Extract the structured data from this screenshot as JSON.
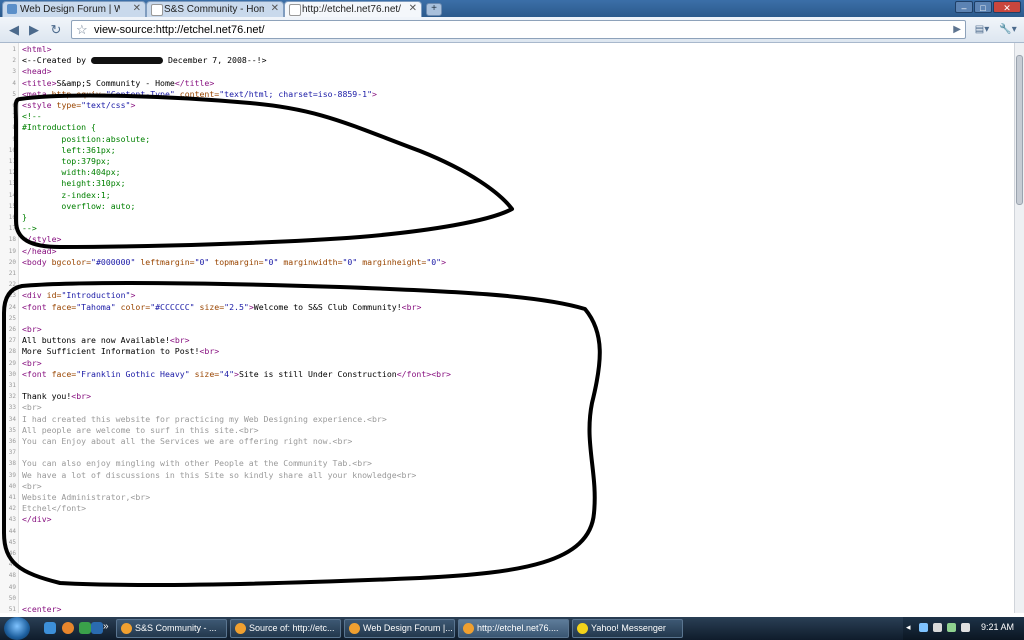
{
  "browser": {
    "tabs": [
      {
        "title": "Web Design Forum | Web...",
        "favicon_color": "#5b8fc9"
      },
      {
        "title": "S&S Community - Home",
        "favicon_color": "#ffffff"
      },
      {
        "title": "http://etchel.net76.net/",
        "favicon_color": "#ffffff"
      }
    ],
    "new_tab_label": "+",
    "window_controls": {
      "minimize": "–",
      "maximize": "□",
      "close": "✕"
    },
    "toolbar": {
      "back_icon": "back-arrow-icon",
      "forward_icon": "forward-arrow-icon",
      "reload_icon": "reload-icon",
      "url": "view-source:http://etchel.net76.net/",
      "go_label": "▶",
      "page_menu_label": "▾",
      "wrench_menu_label": "▾"
    }
  },
  "source": {
    "lines": [
      {
        "n": "1",
        "html": "<span class='tag'>&lt;html&gt;</span>"
      },
      {
        "n": "2",
        "html": "&lt;--Created by <span class='redact'></span> December 7, 2008--!&gt;"
      },
      {
        "n": "3",
        "html": "<span class='tag'>&lt;head&gt;</span>"
      },
      {
        "n": "4",
        "html": "<span class='tag'>&lt;title&gt;</span>S&amp;amp;S Community - Home<span class='tag'>&lt;/title&gt;</span>"
      },
      {
        "n": "5",
        "html": "<span class='tag'>&lt;meta</span> <span class='attr'>http-equiv=</span><span class='val'>\"Content-Type\"</span> <span class='attr'>content=</span><span class='val'>\"text/html; charset=iso-8859-1\"</span><span class='tag'>&gt;</span>"
      },
      {
        "n": "6",
        "html": "<span class='tag'>&lt;style</span> <span class='attr'>type=</span><span class='val'>\"text/css\"</span><span class='tag'>&gt;</span>"
      },
      {
        "n": "7",
        "html": "<span class='css'>&lt;!--</span>"
      },
      {
        "n": "8",
        "html": "<span class='css'>#Introduction {</span>"
      },
      {
        "n": "9",
        "html": "<span class='css'>        position:absolute;</span>"
      },
      {
        "n": "10",
        "html": "<span class='css'>        left:361px;</span>"
      },
      {
        "n": "11",
        "html": "<span class='css'>        top:379px;</span>"
      },
      {
        "n": "12",
        "html": "<span class='css'>        width:404px;</span>"
      },
      {
        "n": "13",
        "html": "<span class='css'>        height:310px;</span>"
      },
      {
        "n": "14",
        "html": "<span class='css'>        z-index:1;</span>"
      },
      {
        "n": "15",
        "html": "<span class='css'>        overflow: auto;</span>"
      },
      {
        "n": "16",
        "html": "<span class='css'>}</span>"
      },
      {
        "n": "17",
        "html": "<span class='css'>--&gt;</span>"
      },
      {
        "n": "18",
        "html": "<span class='tag'>&lt;/style&gt;</span>"
      },
      {
        "n": "19",
        "html": "<span class='tag'>&lt;/head&gt;</span>"
      },
      {
        "n": "20",
        "html": "<span class='tag'>&lt;body</span> <span class='attr'>bgcolor=</span><span class='val'>\"#000000\"</span> <span class='attr'>leftmargin=</span><span class='val'>\"0\"</span> <span class='attr'>topmargin=</span><span class='val'>\"0\"</span> <span class='attr'>marginwidth=</span><span class='val'>\"0\"</span> <span class='attr'>marginheight=</span><span class='val'>\"0\"</span><span class='tag'>&gt;</span>"
      },
      {
        "n": "21",
        "html": ""
      },
      {
        "n": "22",
        "html": ""
      },
      {
        "n": "23",
        "html": "<span class='tag'>&lt;div</span> <span class='attr'>id=</span><span class='val'>\"Introduction\"</span><span class='tag'>&gt;</span>"
      },
      {
        "n": "24",
        "html": "<span class='tag'>&lt;font</span> <span class='attr'>face=</span><span class='val'>\"Tahoma\"</span> <span class='attr'>color=</span><span class='val'>\"#CCCCCC\"</span> <span class='attr'>size=</span><span class='val'>\"2.5\"</span><span class='tag'>&gt;</span>Welcome to S&amp;S Club Community!<span class='tag'>&lt;br&gt;</span>"
      },
      {
        "n": "25",
        "html": ""
      },
      {
        "n": "26",
        "html": "<span class='tag'>&lt;br&gt;</span>"
      },
      {
        "n": "27",
        "html": "All buttons are now Available!<span class='tag'>&lt;br&gt;</span>"
      },
      {
        "n": "28",
        "html": "More Sufficient Information to Post!<span class='tag'>&lt;br&gt;</span>"
      },
      {
        "n": "29",
        "html": "<span class='tag'>&lt;br&gt;</span>"
      },
      {
        "n": "30",
        "html": "<span class='tag'>&lt;font</span> <span class='attr'>face=</span><span class='val'>\"Franklin Gothic Heavy\"</span> <span class='attr'>size=</span><span class='val'>\"4\"</span><span class='tag'>&gt;</span>Site is still Under Construction<span class='tag'>&lt;/font&gt;&lt;br&gt;</span>"
      },
      {
        "n": "31",
        "html": ""
      },
      {
        "n": "32",
        "html": "Thank you!<span class='tag'>&lt;br&gt;</span>"
      },
      {
        "n": "33",
        "html": "<span class='faint'>&lt;br&gt;</span>"
      },
      {
        "n": "34",
        "html": "<span class='faint'>I had created this website for practicing my Web Designing experience.&lt;br&gt;</span>"
      },
      {
        "n": "35",
        "html": "<span class='faint'>All people are welcome to surf in this site.&lt;br&gt;</span>"
      },
      {
        "n": "36",
        "html": "<span class='faint'>You can Enjoy about all the Services we are offering right now.&lt;br&gt;</span>"
      },
      {
        "n": "37",
        "html": ""
      },
      {
        "n": "38",
        "html": "<span class='faint'>You can also enjoy mingling with other People at the Community Tab.&lt;br&gt;</span>"
      },
      {
        "n": "39",
        "html": "<span class='faint'>We have a lot of discussions in this Site so kindly share all your knowledge&lt;br&gt;</span>"
      },
      {
        "n": "40",
        "html": "<span class='faint'>&lt;br&gt;</span>"
      },
      {
        "n": "41",
        "html": "<span class='faint'>Website Administrator,&lt;br&gt;</span>"
      },
      {
        "n": "42",
        "html": "<span class='faint'>Etchel&lt;/font&gt;</span>"
      },
      {
        "n": "43",
        "html": "<span class='tag'>&lt;/div&gt;</span>"
      },
      {
        "n": "44",
        "html": ""
      },
      {
        "n": "45",
        "html": ""
      },
      {
        "n": "46",
        "html": ""
      },
      {
        "n": "47",
        "html": ""
      },
      {
        "n": "48",
        "html": ""
      },
      {
        "n": "49",
        "html": ""
      },
      {
        "n": "50",
        "html": ""
      },
      {
        "n": "51",
        "html": "<span class='tag'>&lt;center&gt;</span>"
      }
    ]
  },
  "taskbar": {
    "items": [
      {
        "label": "S&S Community - ...",
        "icon_color": "#f0a030",
        "active": false
      },
      {
        "label": "Source of: http://etc...",
        "icon_color": "#f0a030",
        "active": false
      },
      {
        "label": "Web Design Forum |...",
        "icon_color": "#f0a030",
        "active": false
      },
      {
        "label": "http://etchel.net76....",
        "icon_color": "#f0a030",
        "active": true
      },
      {
        "label": "Yahoo! Messenger",
        "icon_color": "#f2d31b",
        "active": false
      }
    ],
    "show_desktop_label": "»",
    "tray_expand_label": "◂",
    "clock": "9:21 AM"
  },
  "colors": {
    "annotation_ink": "#000000"
  }
}
